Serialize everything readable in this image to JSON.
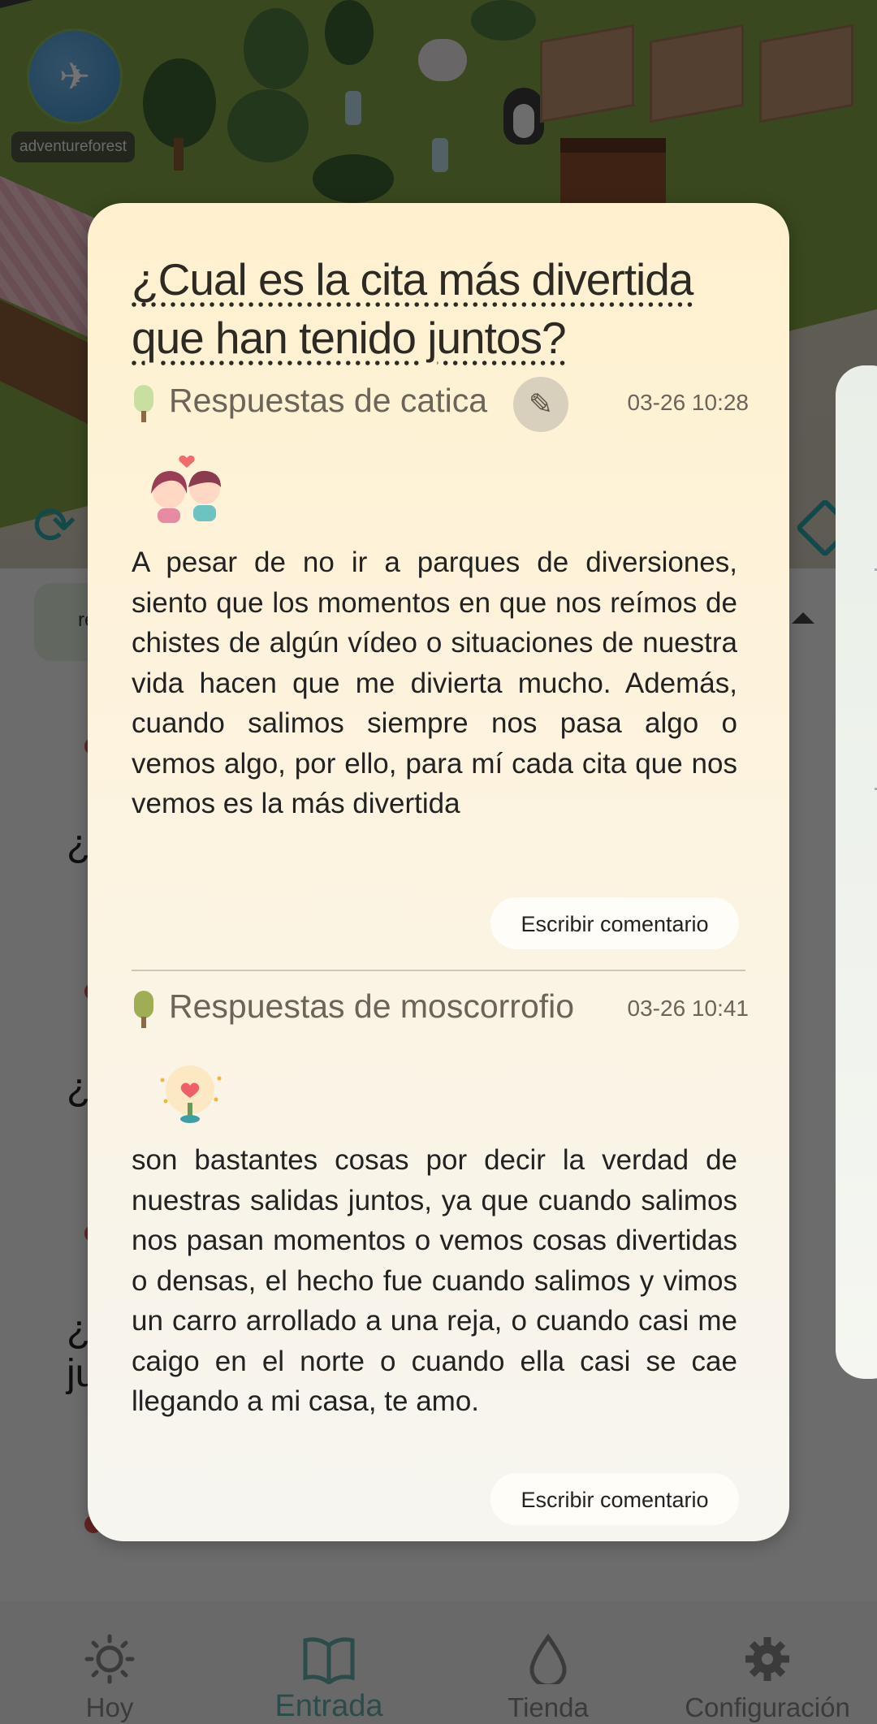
{
  "world": {
    "label": "adventureforest"
  },
  "behind": {
    "filter_pill": "re",
    "q_prefix_1": "¿l",
    "q_prefix_2": "¿(",
    "q_prefix_3": "¿(",
    "q_prefix_3b": "ju"
  },
  "modal": {
    "question": "¿Cual es la cita más divertida que han tenido juntos?",
    "answers": [
      {
        "title": "Respuestas de catica",
        "time": "03-26 10:28",
        "text": "A pesar de no ir a parques de diversiones, siento que los momentos en que nos reímos de chistes de algún vídeo o situaciones de nuestra vida hacen que me divierta mucho. Además, cuando salimos siempre nos pasa algo o vemos algo, por ello, para mí cada cita que nos vemos es la más divertida",
        "comment_label": "Escribir comentario"
      },
      {
        "title": "Respuestas de moscorrofio",
        "time": "03-26 10:41",
        "text": "son bastantes cosas por decir la verdad de nuestras salidas juntos, ya que cuando salimos nos pasan momentos o vemos cosas divertidas o densas, el hecho fue cuando salimos y vimos un carro arrollado a una reja, o cuando casi me caigo en el norte o cuando ella casi se cae llegando a mi casa, te amo.",
        "comment_label": "Escribir comentario"
      }
    ]
  },
  "nav": [
    {
      "label": "Hoy",
      "icon": "sun-icon"
    },
    {
      "label": "Entrada",
      "icon": "book-icon"
    },
    {
      "label": "Tienda",
      "icon": "drop-icon"
    },
    {
      "label": "Configuración",
      "icon": "gear-icon"
    }
  ],
  "colors": {
    "accent": "#2aa3a5",
    "modal_bg": "#fff1cf",
    "nav_bg": "#696969"
  }
}
